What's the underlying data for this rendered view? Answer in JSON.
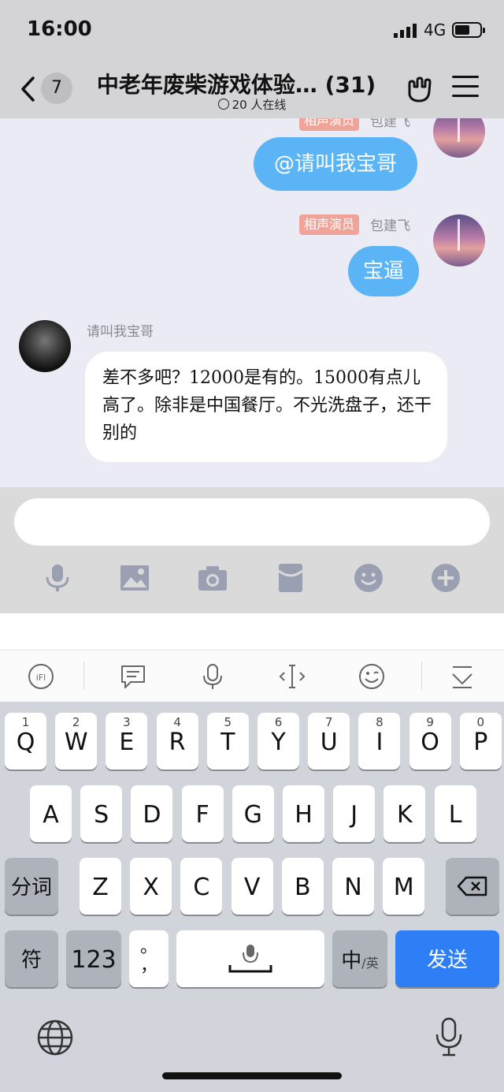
{
  "status_bar": {
    "time": "16:00",
    "network": "4G"
  },
  "header": {
    "back_count": "7",
    "title": "中老年废柴游戏体验…  (31)",
    "online": "20 人在线"
  },
  "messages": [
    {
      "tag": "相声演员",
      "name": "包建飞",
      "text": "@请叫我宝哥",
      "side": "right"
    },
    {
      "tag": "相声演员",
      "name": "包建飞",
      "text": "宝逼",
      "side": "right"
    },
    {
      "name": "请叫我宝哥",
      "text": "差不多吧？12000是有的。15000有点儿高了。除非是中国餐厅。不光洗盘子，还干别的",
      "side": "left"
    }
  ],
  "input": {
    "placeholder": ""
  },
  "toolbar_icons": [
    "microphone-icon",
    "image-icon",
    "camera-icon",
    "red-packet-icon",
    "emoji-icon",
    "plus-icon"
  ],
  "keyboard": {
    "row1": [
      {
        "k": "Q",
        "n": "1"
      },
      {
        "k": "W",
        "n": "2"
      },
      {
        "k": "E",
        "n": "3"
      },
      {
        "k": "R",
        "n": "4"
      },
      {
        "k": "T",
        "n": "5"
      },
      {
        "k": "Y",
        "n": "6"
      },
      {
        "k": "U",
        "n": "7"
      },
      {
        "k": "I",
        "n": "8"
      },
      {
        "k": "O",
        "n": "9"
      },
      {
        "k": "P",
        "n": "0"
      }
    ],
    "row2": [
      "A",
      "S",
      "D",
      "F",
      "G",
      "H",
      "J",
      "K",
      "L"
    ],
    "row3": [
      "Z",
      "X",
      "C",
      "V",
      "B",
      "N",
      "M"
    ],
    "shift_label": "分词",
    "symbols_label": "符",
    "numbers_label": "123",
    "punct_label": "。\n，",
    "lang_label": "中",
    "lang_sub": "/英",
    "send_label": "发送"
  },
  "colors": {
    "accent": "#2e7ff6",
    "bubble_out": "#5ab4f5",
    "tag": "#f0a399",
    "chat_bg": "#ebebf5"
  }
}
